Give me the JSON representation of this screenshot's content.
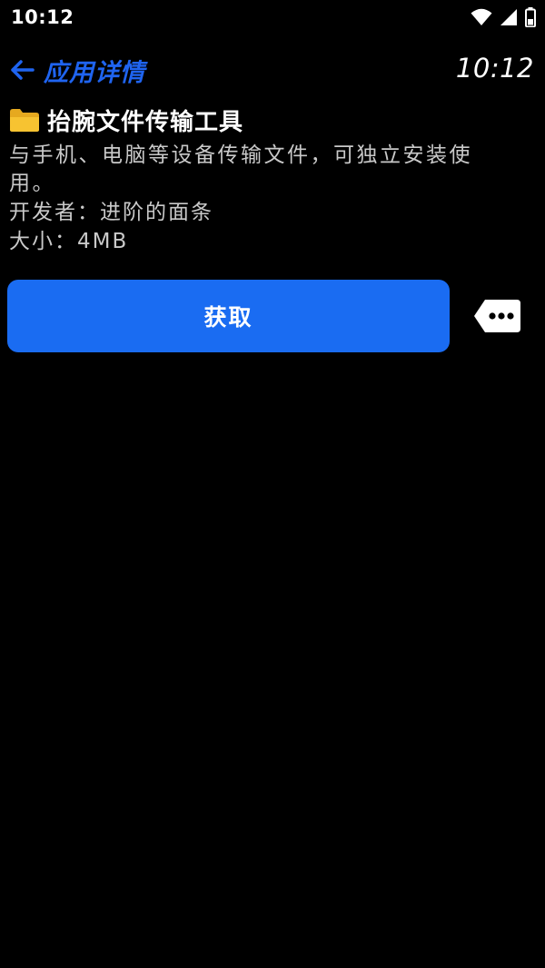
{
  "status_bar": {
    "time": "10:12",
    "icons": [
      "wifi-icon",
      "signal-icon",
      "battery-icon"
    ]
  },
  "header": {
    "back_label": "应用详情",
    "clock": "10:12"
  },
  "app": {
    "icon": "folder-icon",
    "name": "抬腕文件传输工具",
    "description": "与手机、电脑等设备传输文件，可独立安装使用。",
    "developer": "开发者：进阶的面条",
    "size": "大小：4MB"
  },
  "actions": {
    "get_label": "获取",
    "more_icon": "more-icon"
  },
  "colors": {
    "background": "#000000",
    "accent": "#1a6cf2",
    "header_accent": "#1f64f0",
    "secondary_text": "#c9c9c9",
    "folder": "#f7c331"
  }
}
